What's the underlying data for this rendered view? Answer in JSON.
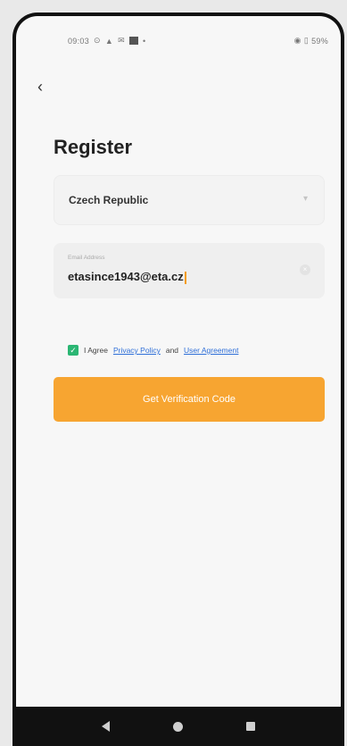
{
  "status": {
    "time": "09:03",
    "battery": "59%"
  },
  "page": {
    "title": "Register"
  },
  "country": {
    "value": "Czech Republic"
  },
  "email": {
    "label": "Email Address",
    "value": "etasince1943@eta.cz"
  },
  "agreement": {
    "prefix": "I Agree",
    "privacy_link": "Privacy Policy",
    "and": "and",
    "user_link": "User Agreement",
    "checked": true
  },
  "button": {
    "label": "Get Verification Code"
  },
  "colors": {
    "accent": "#f7a531",
    "checkbox": "#2bb673",
    "link": "#2f6fd8"
  }
}
